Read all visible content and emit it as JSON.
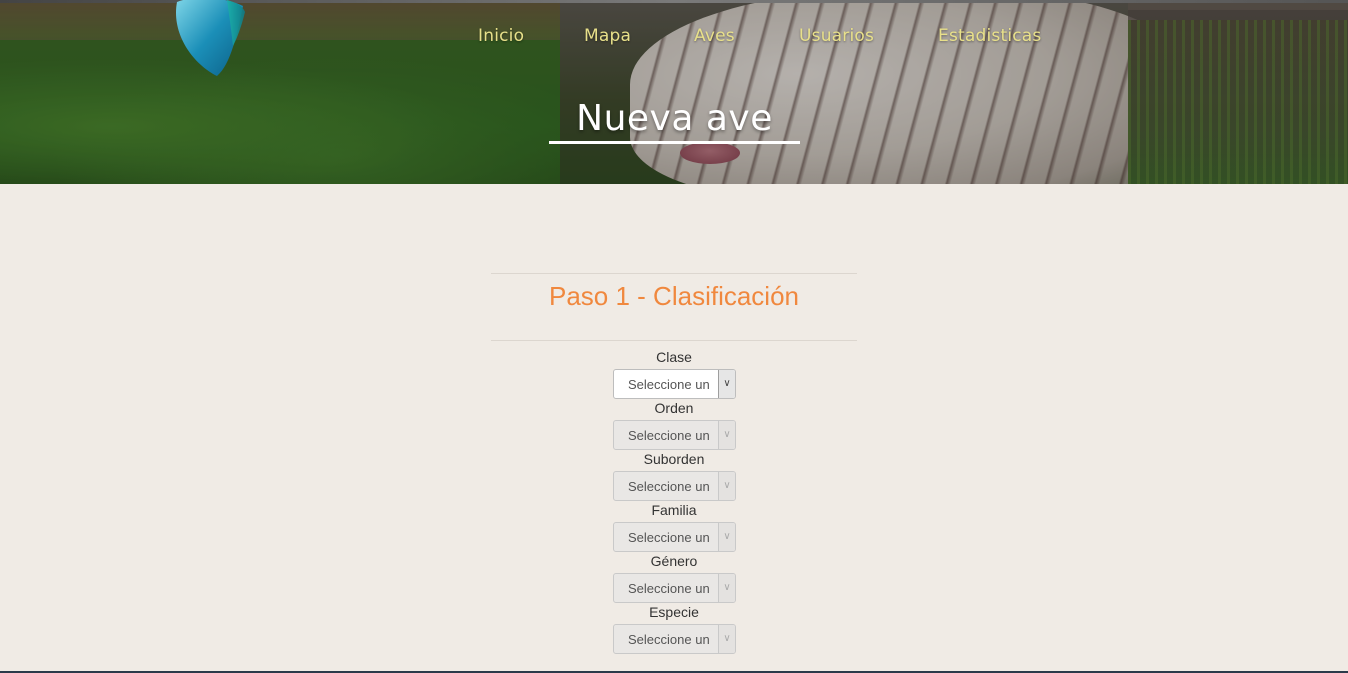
{
  "nav": {
    "items": [
      {
        "label": "Inicio"
      },
      {
        "label": "Mapa"
      },
      {
        "label": "Aves"
      },
      {
        "label": "Usuarios"
      },
      {
        "label": "Estadisticas"
      }
    ]
  },
  "header": {
    "title": "Nueva ave"
  },
  "form": {
    "step_title": "Paso 1 - Clasificación",
    "fields": [
      {
        "label": "Clase",
        "value": "Seleccione un",
        "enabled": true
      },
      {
        "label": "Orden",
        "value": "Seleccione un",
        "enabled": false
      },
      {
        "label": "Suborden",
        "value": "Seleccione un",
        "enabled": false
      },
      {
        "label": "Familia",
        "value": "Seleccione un",
        "enabled": false
      },
      {
        "label": "Género",
        "value": "Seleccione un",
        "enabled": false
      },
      {
        "label": "Especie",
        "value": "Seleccione un",
        "enabled": false
      }
    ]
  },
  "colors": {
    "accent_orange": "#f0883e",
    "nav_text": "#e8e08a",
    "page_background": "#f0ebe5"
  },
  "icons": {
    "logo": "leaf-logo-icon",
    "select_arrow": "chevron-down-icon"
  }
}
